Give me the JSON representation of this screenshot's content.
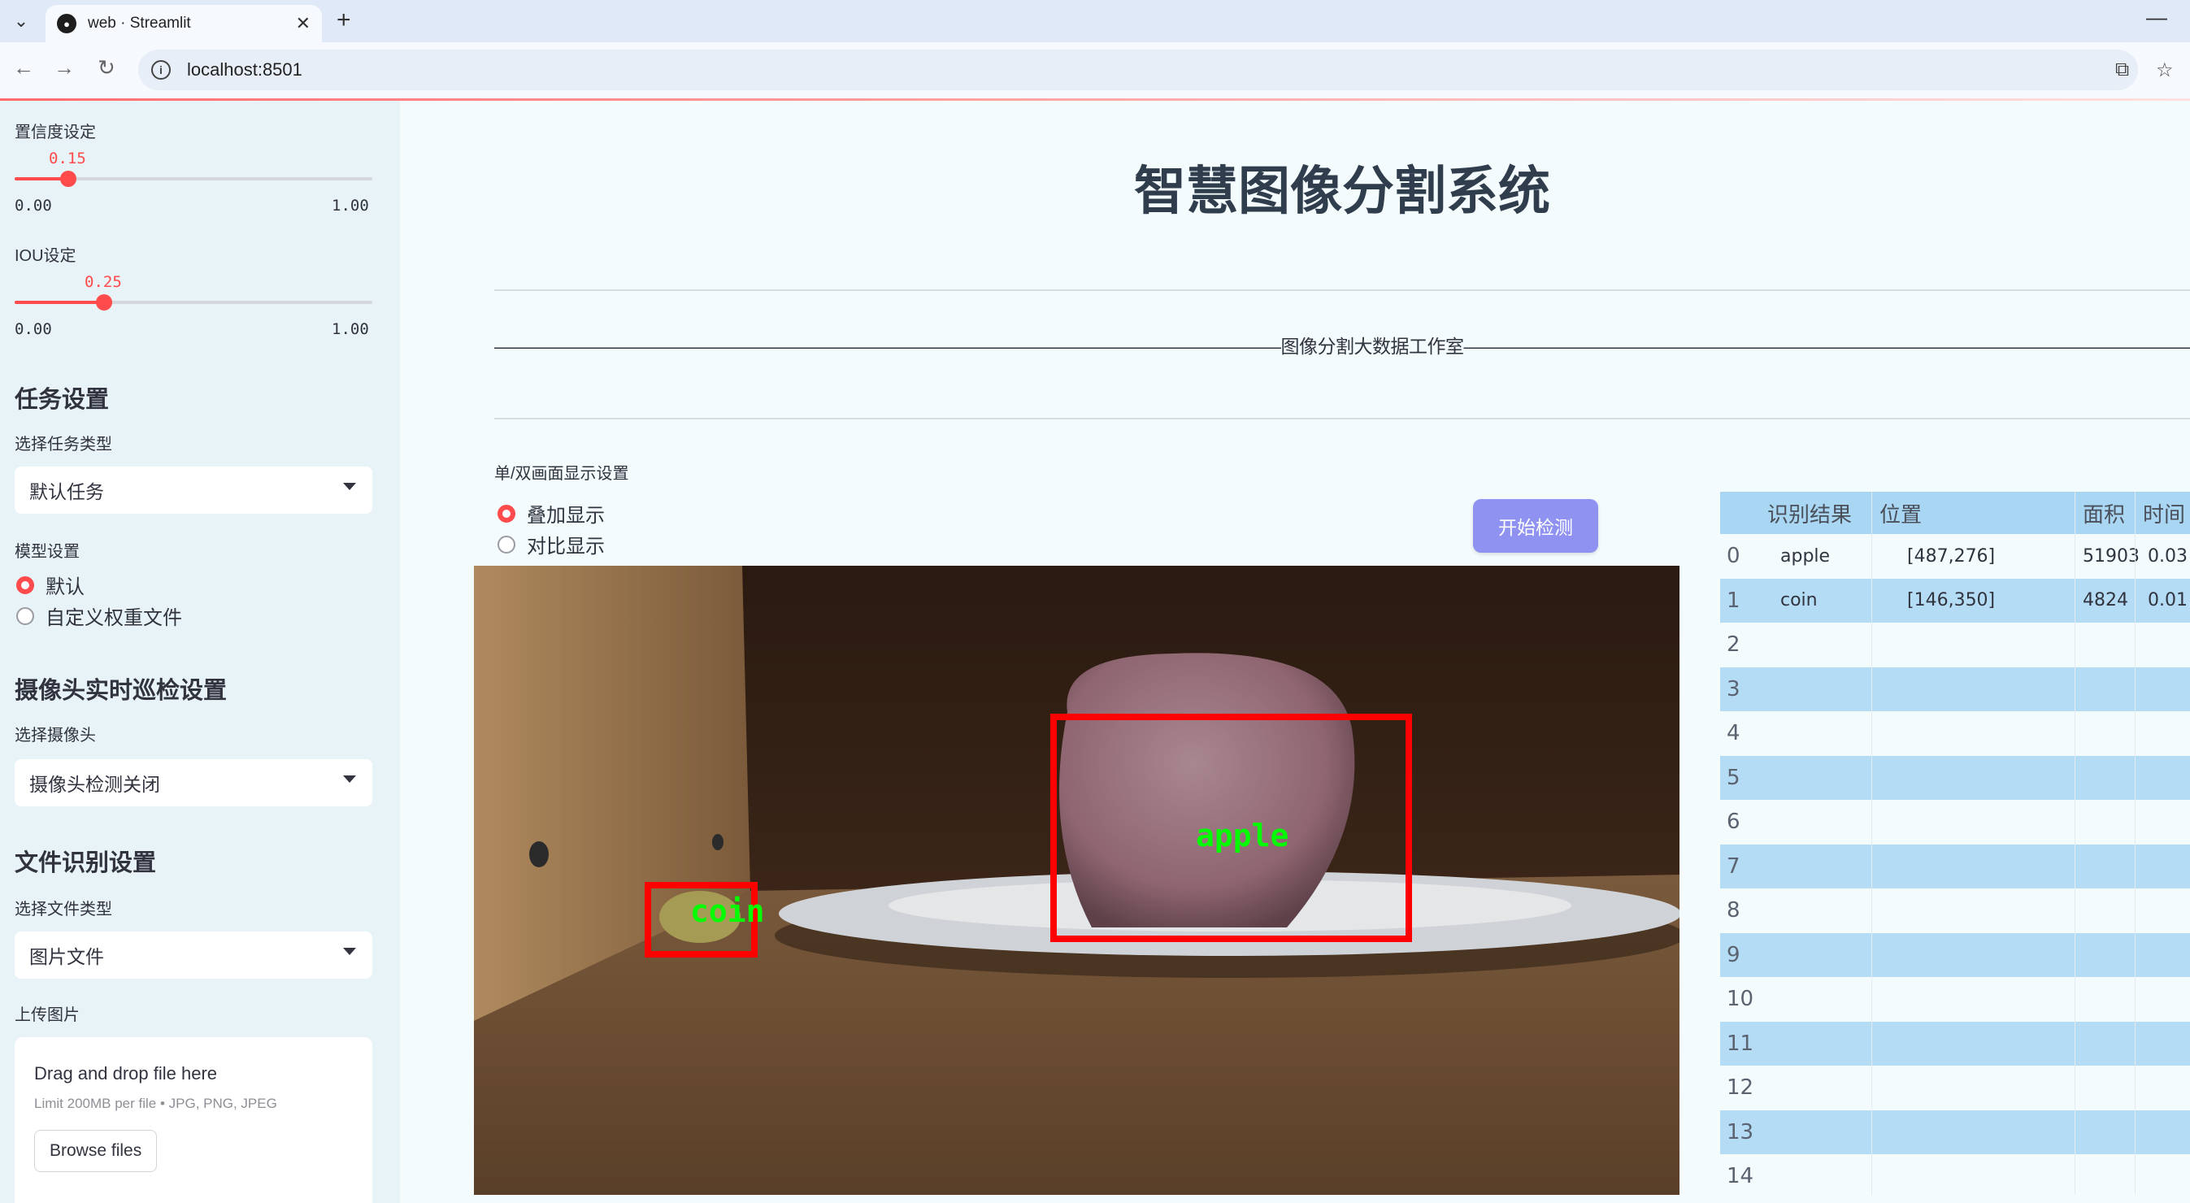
{
  "browser": {
    "tab_title": "web · Streamlit",
    "url": "localhost:8501"
  },
  "sidebar": {
    "confidence": {
      "label": "置信度设定",
      "value": 0.15,
      "value_text": "0.15",
      "min": "0.00",
      "max": "1.00"
    },
    "iou": {
      "label": "IOU设定",
      "value": 0.25,
      "value_text": "0.25",
      "min": "0.00",
      "max": "1.00"
    },
    "task_section": {
      "heading": "任务设置",
      "select_label": "选择任务类型",
      "selected": "默认任务"
    },
    "model_section": {
      "label": "模型设置",
      "options": [
        "默认",
        "自定义权重文件"
      ],
      "selected_index": 0
    },
    "camera_section": {
      "heading": "摄像头实时巡检设置",
      "select_label": "选择摄像头",
      "selected": "摄像头检测关闭"
    },
    "file_section": {
      "heading": "文件识别设置",
      "select_label": "选择文件类型",
      "selected": "图片文件"
    },
    "upload": {
      "label": "上传图片",
      "drop_text": "Drag and drop file here",
      "limit_text": "Limit 200MB per file • JPG, PNG, JPEG",
      "browse_label": "Browse files"
    }
  },
  "main": {
    "title": "智慧图像分割系统",
    "divider_text": "———————————————————————————————————————————图像分割大数据工作室————————————————————————————————————————————",
    "display_label": "单/双画面显示设置",
    "display_options": [
      "叠加显示",
      "对比显示"
    ],
    "display_selected_index": 0,
    "detect_button": "开始检测"
  },
  "detections": [
    {
      "label": "apple",
      "box_color": "#ff0000",
      "text_color": "#00ff00"
    },
    {
      "label": "coin",
      "box_color": "#ff0000",
      "text_color": "#00ff00"
    }
  ],
  "results_table": {
    "columns": [
      "识别结果",
      "位置",
      "面积",
      "时间"
    ],
    "rows": [
      {
        "index": "0",
        "result": "apple",
        "position": "[487,276]",
        "area": "51903",
        "time": "0.03"
      },
      {
        "index": "1",
        "result": "coin",
        "position": "[146,350]",
        "area": "4824",
        "time": "0.01"
      },
      {
        "index": "2",
        "result": "",
        "position": "",
        "area": "",
        "time": ""
      },
      {
        "index": "3",
        "result": "",
        "position": "",
        "area": "",
        "time": ""
      },
      {
        "index": "4",
        "result": "",
        "position": "",
        "area": "",
        "time": ""
      },
      {
        "index": "5",
        "result": "",
        "position": "",
        "area": "",
        "time": ""
      },
      {
        "index": "6",
        "result": "",
        "position": "",
        "area": "",
        "time": ""
      },
      {
        "index": "7",
        "result": "",
        "position": "",
        "area": "",
        "time": ""
      },
      {
        "index": "8",
        "result": "",
        "position": "",
        "area": "",
        "time": ""
      },
      {
        "index": "9",
        "result": "",
        "position": "",
        "area": "",
        "time": ""
      },
      {
        "index": "10",
        "result": "",
        "position": "",
        "area": "",
        "time": ""
      },
      {
        "index": "11",
        "result": "",
        "position": "",
        "area": "",
        "time": ""
      },
      {
        "index": "12",
        "result": "",
        "position": "",
        "area": "",
        "time": ""
      },
      {
        "index": "13",
        "result": "",
        "position": "",
        "area": "",
        "time": ""
      },
      {
        "index": "14",
        "result": "",
        "position": "",
        "area": "",
        "time": ""
      }
    ]
  },
  "colors": {
    "accent": "#ff4b4b",
    "button": "#8f92f0",
    "sidebar_bg": "#e8f3f8",
    "table_stripe": "#b5dcf5"
  }
}
